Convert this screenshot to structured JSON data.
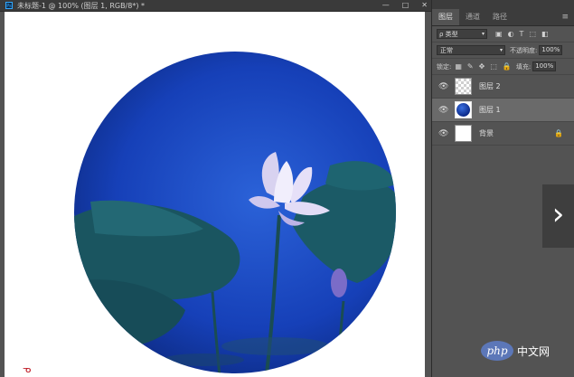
{
  "document": {
    "badge": "Ps",
    "title": "未标题-1 @ 100% (图层 1, RGB/8*) *",
    "controls": [
      "—",
      "□",
      "✕"
    ]
  },
  "canvas": {
    "watermark_mark": "ᓀ"
  },
  "panel": {
    "tabs": [
      "图层",
      "通道",
      "路径"
    ],
    "menu_icon": "≡",
    "filter": {
      "label": "ρ 类型",
      "caret": "▾"
    },
    "filter_icons": [
      "▣",
      "◐",
      "T",
      "⬚",
      "◧"
    ],
    "blend": {
      "mode": "正常",
      "caret": "▾",
      "opacity_label": "不透明度:",
      "opacity_value": "100%"
    },
    "lock": {
      "label": "锁定:",
      "icons": [
        "▦",
        "✎",
        "✥",
        "⬚",
        "🔒"
      ],
      "fill_label": "填充:",
      "fill_value": "100%"
    },
    "layers": [
      {
        "name": "图层 2",
        "thumb": "transparent",
        "selected": false
      },
      {
        "name": "图层 1",
        "thumb": "circle",
        "selected": true
      },
      {
        "name": "背景",
        "thumb": "white",
        "selected": false,
        "locked": true
      }
    ],
    "eye_icon": "👁",
    "lock_badge": "🔒"
  },
  "overlay": {
    "next_arrow": "›",
    "watermark_logo": "php",
    "watermark_text": "中文网"
  },
  "colors": {
    "app_bg": "#535353",
    "tab_bg": "#3a3a3a",
    "selected_layer": "#6a6a6a",
    "lotus_blue_deep": "#0a2f9c",
    "lotus_blue_light": "#2b62d8"
  }
}
